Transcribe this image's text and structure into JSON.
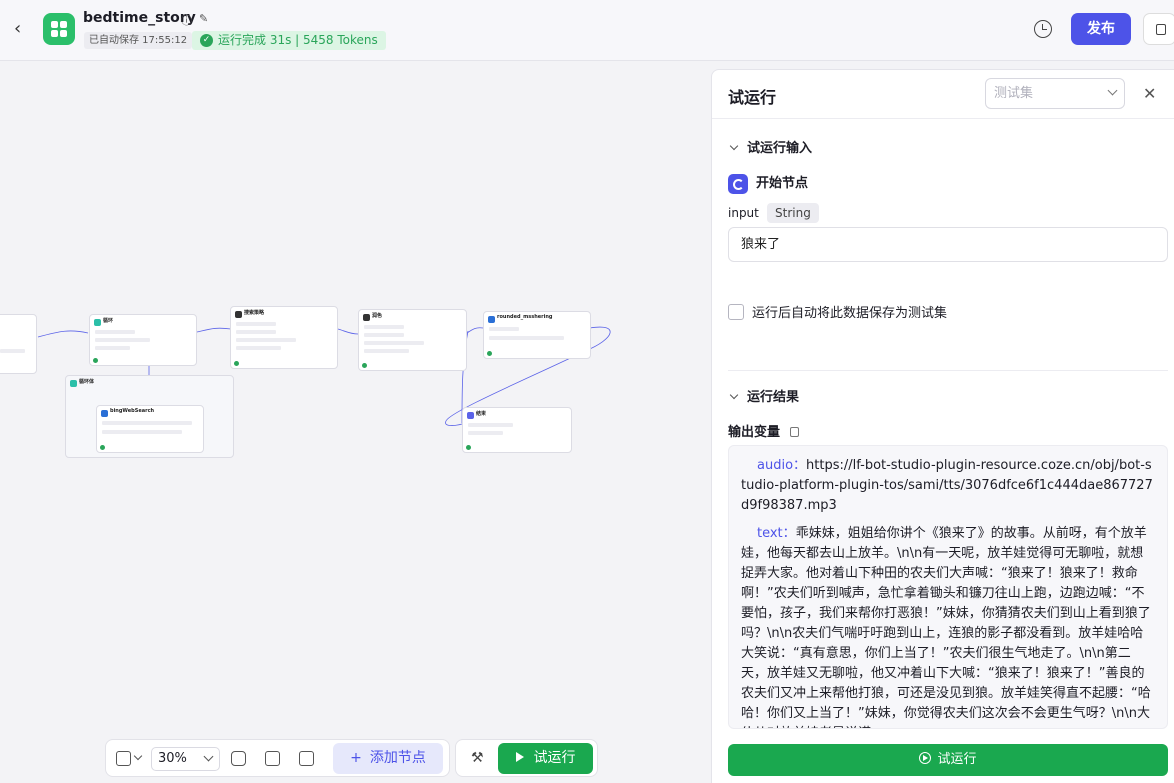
{
  "header": {
    "app_name": "bedtime_story",
    "autosave": "已自动保存 17:55:12",
    "run_status": "运行完成 31s | 5458 Tokens",
    "publish_label": "发布"
  },
  "canvas": {
    "nodes": [
      {
        "title": "循环"
      },
      {
        "title": "搜索策略"
      },
      {
        "title": "润色"
      },
      {
        "title": "rounded_msshering"
      },
      {
        "title": "循环体"
      },
      {
        "title": "bingWebSearch"
      },
      {
        "title": "结束"
      }
    ]
  },
  "toolbar": {
    "zoom": "30%",
    "add_node_label": "添加节点",
    "run_label": "试运行"
  },
  "panel": {
    "title": "试运行",
    "testset_placeholder": "测试集",
    "input_section": "试运行输入",
    "start_node": "开始节点",
    "input_name": "input",
    "input_type": "String",
    "input_value": "狼来了",
    "save_checkbox": "运行后自动将此数据保存为测试集",
    "result_section": "运行结果",
    "output_label": "输出变量",
    "audio_key": "audio",
    "audio_value": "https://lf-bot-studio-plugin-resource.coze.cn/obj/bot-studio-platform-plugin-tos/sami/tts/3076dfce6f1c444dae867727d9f98387.mp3",
    "text_key": "text",
    "text_value": "乖妹妹，姐姐给你讲个《狼来了》的故事。从前呀，有个放羊娃，他每天都去山上放羊。\\n\\n有一天呢，放羊娃觉得可无聊啦，就想捉弄大家。他对着山下种田的农夫们大声喊：“狼来了！狼来了！救命啊！”农夫们听到喊声，急忙拿着锄头和镰刀往山上跑，边跑边喊：“不要怕，孩子，我们来帮你打恶狼！”妹妹，你猜猜农夫们到山上看到狼了吗？\\n\\n农夫们气喘吁吁跑到山上，连狼的影子都没看到。放羊娃哈哈大笑说：“真有意思，你们上当了！”农夫们很生气地走了。\\n\\n第二天，放羊娃又无聊啦，他又冲着山下大喊：“狼来了！狼来了！”善良的农夫们又冲上来帮他打狼，可还是没见到狼。放羊娃笑得直不起腰：“哈哈！你们又上当了！”妹妹，你觉得农夫们这次会不会更生气呀？\\n\\n大伙儿对放羊娃老是说谎",
    "run_button": "试运行"
  }
}
